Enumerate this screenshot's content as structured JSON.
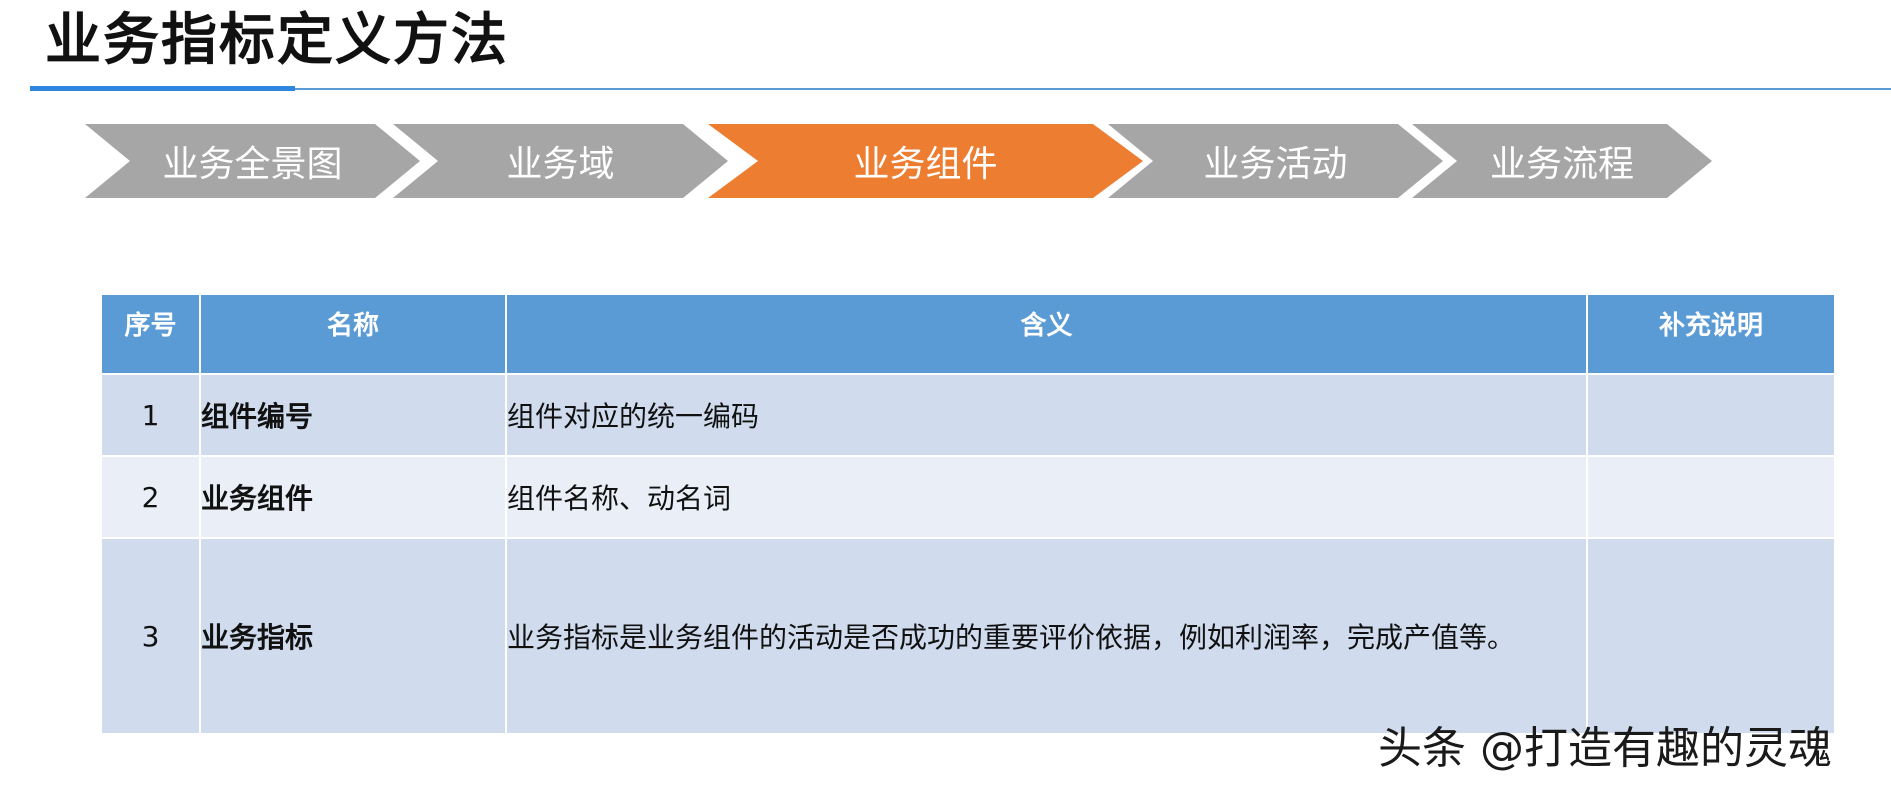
{
  "page": {
    "title": "业务指标定义方法"
  },
  "steps": [
    {
      "label": "业务全景图",
      "active": false
    },
    {
      "label": "业务域",
      "active": false
    },
    {
      "label": "业务组件",
      "active": true
    },
    {
      "label": "业务活动",
      "active": false
    },
    {
      "label": "业务流程",
      "active": false
    }
  ],
  "colors": {
    "step_inactive": "#A6A6A6",
    "step_active": "#ED7D31",
    "table_header": "#5B9BD5",
    "row_dark": "#D0DCEE",
    "row_light": "#E9EEF7"
  },
  "table": {
    "headers": [
      "序号",
      "名称",
      "含义",
      "补充说明"
    ],
    "rows": [
      {
        "index": "1",
        "name": "组件编号",
        "definition": "组件对应的统一编码",
        "note": ""
      },
      {
        "index": "2",
        "name": "业务组件",
        "definition": "组件名称、动名词",
        "note": ""
      },
      {
        "index": "3",
        "name": "业务指标",
        "definition": "业务指标是业务组件的活动是否成功的重要评价依据，例如利润率，完成产值等。",
        "note": ""
      }
    ]
  },
  "watermark": {
    "text": "头条 @打造有趣的灵魂"
  }
}
